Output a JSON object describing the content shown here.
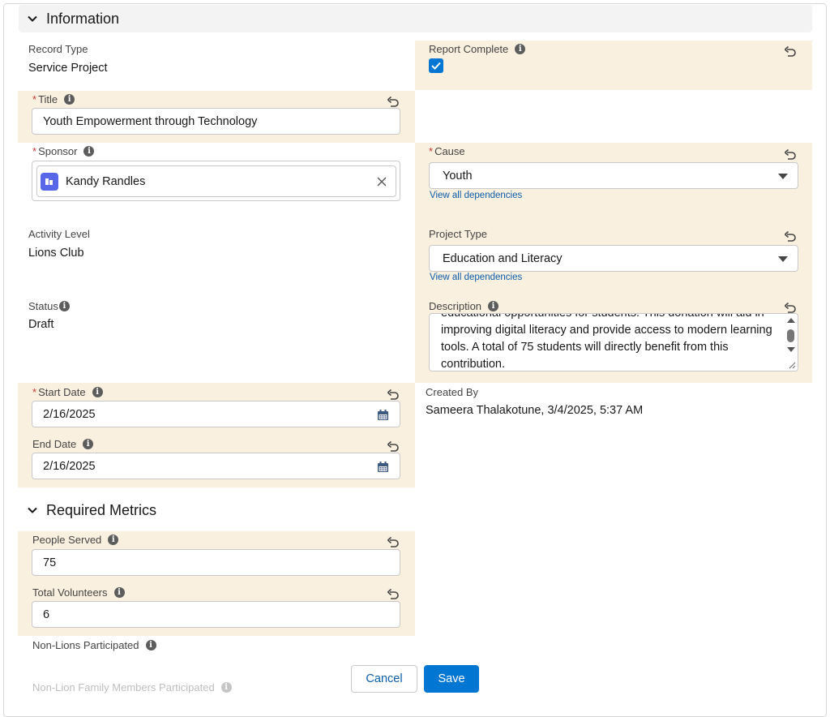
{
  "sections": {
    "information": "Information",
    "required_metrics": "Required Metrics"
  },
  "fields": {
    "record_type": {
      "label": "Record Type",
      "value": "Service Project"
    },
    "report_complete": {
      "label": "Report Complete",
      "checked": true
    },
    "title": {
      "label": "Title",
      "required": "*",
      "value": "Youth Empowerment through Technology"
    },
    "sponsor": {
      "label": "Sponsor",
      "required": "*",
      "value": "Kandy Randles"
    },
    "cause": {
      "label": "Cause",
      "required": "*",
      "value": "Youth",
      "link": "View all dependencies"
    },
    "activity_level": {
      "label": "Activity Level",
      "value": "Lions Club"
    },
    "project_type": {
      "label": "Project Type",
      "value": "Education and Literacy",
      "link": "View all dependencies"
    },
    "status": {
      "label": "Status",
      "value": "Draft"
    },
    "description": {
      "label": "Description",
      "value": "educational opportunities for students. This donation will aid in improving digital literacy and provide access to modern learning tools. A total of 75 students will directly benefit from this contribution."
    },
    "start_date": {
      "label": "Start Date",
      "required": "*",
      "value": "2/16/2025"
    },
    "end_date": {
      "label": "End Date",
      "value": "2/16/2025"
    },
    "created_by": {
      "label": "Created By",
      "value": "Sameera Thalakotune, 3/4/2025, 5:37 AM"
    },
    "people_served": {
      "label": "People Served",
      "value": "75"
    },
    "total_volunteers": {
      "label": "Total Volunteers",
      "value": "6"
    },
    "non_lions_participated": {
      "label": "Non-Lions Participated"
    },
    "non_lion_family": {
      "label": "Non-Lion Family Members Participated"
    }
  },
  "buttons": {
    "cancel": "Cancel",
    "save": "Save"
  },
  "colors": {
    "highlight": "#faf0df",
    "brand": "#0176d3",
    "link": "#0b5cab",
    "sponsor_icon": "#5867e8"
  },
  "icons": {
    "chevron": "chevron-down-icon",
    "info": "info-icon",
    "undo": "undo-icon",
    "calendar": "calendar-icon",
    "clear": "close-icon",
    "sponsor": "contact-icon"
  }
}
